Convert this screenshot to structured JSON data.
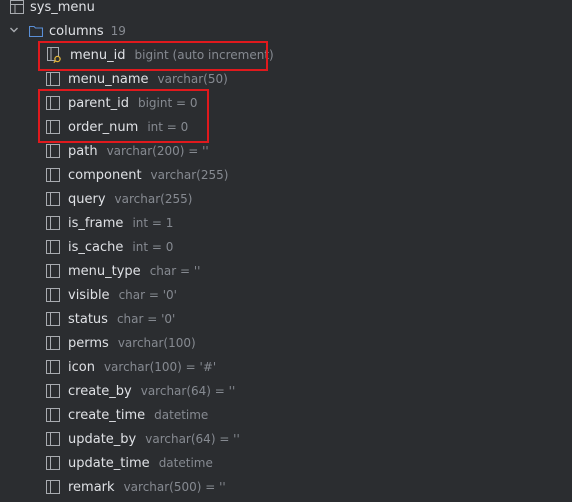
{
  "table": {
    "name": "sys_menu",
    "icon": "table-icon"
  },
  "columns_node": {
    "label": "columns",
    "count": "19",
    "expanded": true,
    "icon": "folder-icon"
  },
  "columns": [
    {
      "name": "menu_id",
      "type": "bigint (auto increment)",
      "icon": "primary-key-column-icon"
    },
    {
      "name": "menu_name",
      "type": "varchar(50)",
      "icon": "column-icon"
    },
    {
      "name": "parent_id",
      "type": "bigint = 0",
      "icon": "column-icon"
    },
    {
      "name": "order_num",
      "type": "int = 0",
      "icon": "column-icon"
    },
    {
      "name": "path",
      "type": "varchar(200) = ''",
      "icon": "column-icon"
    },
    {
      "name": "component",
      "type": "varchar(255)",
      "icon": "column-icon"
    },
    {
      "name": "query",
      "type": "varchar(255)",
      "icon": "column-icon"
    },
    {
      "name": "is_frame",
      "type": "int = 1",
      "icon": "column-icon"
    },
    {
      "name": "is_cache",
      "type": "int = 0",
      "icon": "column-icon"
    },
    {
      "name": "menu_type",
      "type": "char = ''",
      "icon": "column-icon"
    },
    {
      "name": "visible",
      "type": "char = '0'",
      "icon": "column-icon"
    },
    {
      "name": "status",
      "type": "char = '0'",
      "icon": "column-icon"
    },
    {
      "name": "perms",
      "type": "varchar(100)",
      "icon": "column-icon"
    },
    {
      "name": "icon",
      "type": "varchar(100) = '#'",
      "icon": "column-icon"
    },
    {
      "name": "create_by",
      "type": "varchar(64) = ''",
      "icon": "column-icon"
    },
    {
      "name": "create_time",
      "type": "datetime",
      "icon": "column-icon"
    },
    {
      "name": "update_by",
      "type": "varchar(64) = ''",
      "icon": "column-icon"
    },
    {
      "name": "update_time",
      "type": "datetime",
      "icon": "column-icon"
    },
    {
      "name": "remark",
      "type": "varchar(500) = ''",
      "icon": "column-icon"
    }
  ],
  "colors": {
    "background": "#2b2d30",
    "highlight": "#e0191d",
    "text": "#dfe1e5",
    "muted": "#868a91",
    "folder": "#5a8fd6"
  }
}
